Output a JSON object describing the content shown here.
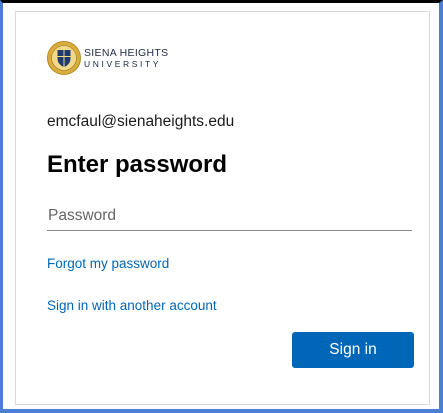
{
  "logo": {
    "name_line1": "SIENA HEIGHTS",
    "name_line2": "UNIVERSITY",
    "seal_icon": "university-seal-icon",
    "colors": {
      "gold": "#d9ad3a",
      "navy": "#1e3a6e"
    }
  },
  "account": {
    "email": "emcfaul@sienaheights.edu"
  },
  "form": {
    "title": "Enter password",
    "password_placeholder": "Password",
    "password_value": "",
    "forgot_link": "Forgot my password",
    "other_account_link": "Sign in with another account",
    "submit_label": "Sign in"
  },
  "colors": {
    "accent": "#0067b8",
    "frame": "#4a7fd4"
  }
}
